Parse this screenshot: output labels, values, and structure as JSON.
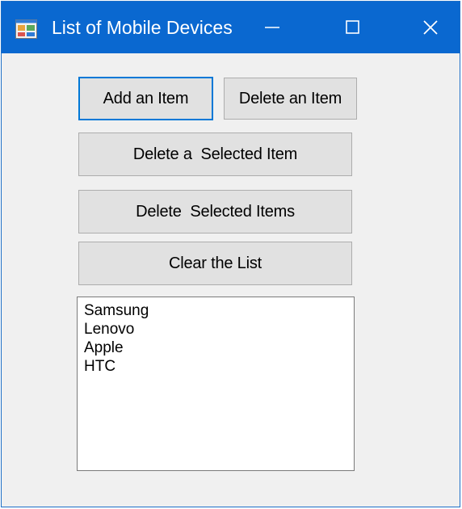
{
  "window": {
    "title": "List of Mobile Devices",
    "icon": "winforms-app-icon",
    "caption_buttons": [
      "minimize-icon",
      "maximize-icon",
      "close-icon"
    ],
    "colors": {
      "titlebar": "#0a68d0",
      "accent": "#0078d7",
      "background": "#f0f0f0"
    }
  },
  "buttons": {
    "add": "Add an Item",
    "delete": "Delete an Item",
    "delete_selected_item": "Delete a  Selected Item",
    "delete_selected_items": "Delete  Selected Items",
    "clear": "Clear the List"
  },
  "listbox": {
    "items": [
      "Samsung",
      "Lenovo",
      "Apple",
      "HTC"
    ]
  }
}
